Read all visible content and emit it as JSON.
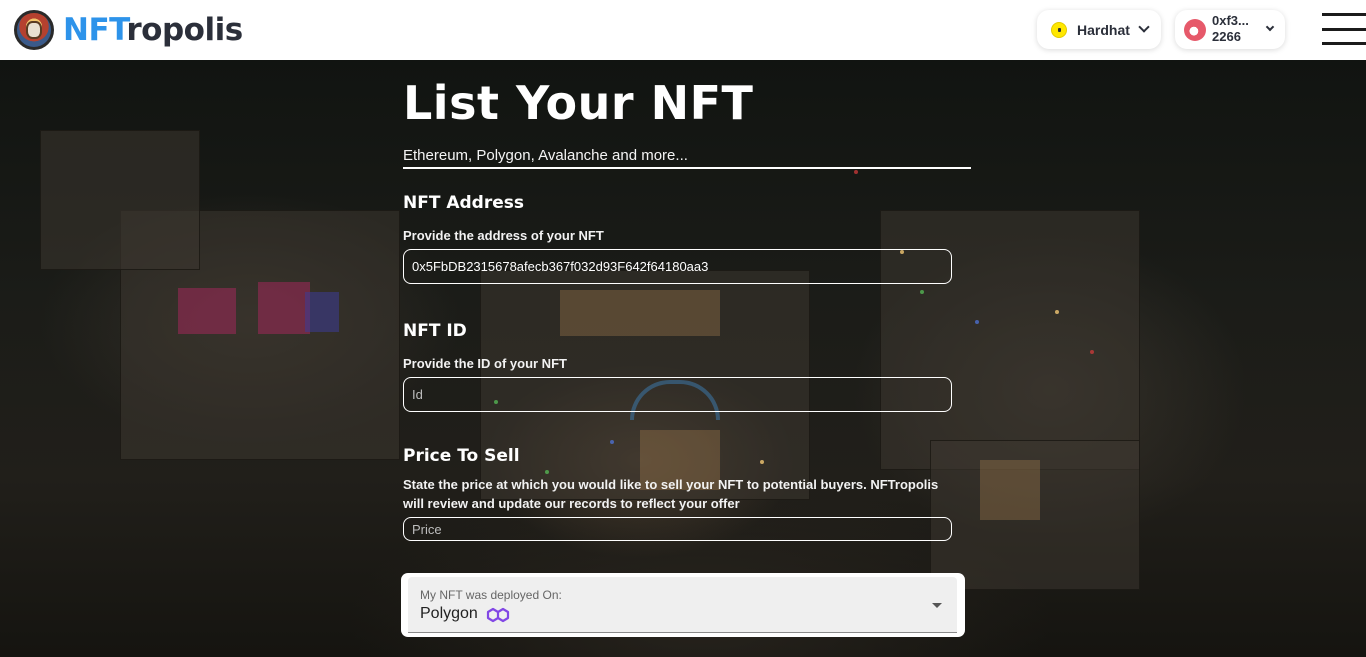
{
  "header": {
    "brand_highlight": "NFT",
    "brand_rest": "ropolis",
    "network": {
      "label": "Hardhat",
      "icon": "hardhat-icon"
    },
    "account": {
      "line1": "0xf3...",
      "line2": "2266"
    },
    "colors": {
      "brand_blue": "#2d93ea",
      "brand_dark": "#2b2f3a"
    }
  },
  "form": {
    "title": "List Your NFT",
    "subtitle": "Ethereum, Polygon, Avalanche and more...",
    "address": {
      "title": "NFT Address",
      "help": "Provide the address of your NFT",
      "value": "0x5FbDB2315678afecb367f032d93F642f64180aa3",
      "placeholder": ""
    },
    "id": {
      "title": "NFT ID",
      "help": "Provide the ID of your NFT",
      "value": "",
      "placeholder": "Id"
    },
    "price": {
      "title": "Price To Sell",
      "help": "State the price at which you would like to sell your NFT to potential buyers. NFTropolis will review and update our records to reflect your offer",
      "value": "",
      "placeholder": "Price"
    },
    "chain": {
      "label": "My NFT was deployed On:",
      "value": "Polygon",
      "icon": "polygon-icon",
      "icon_color": "#8247e5"
    }
  }
}
